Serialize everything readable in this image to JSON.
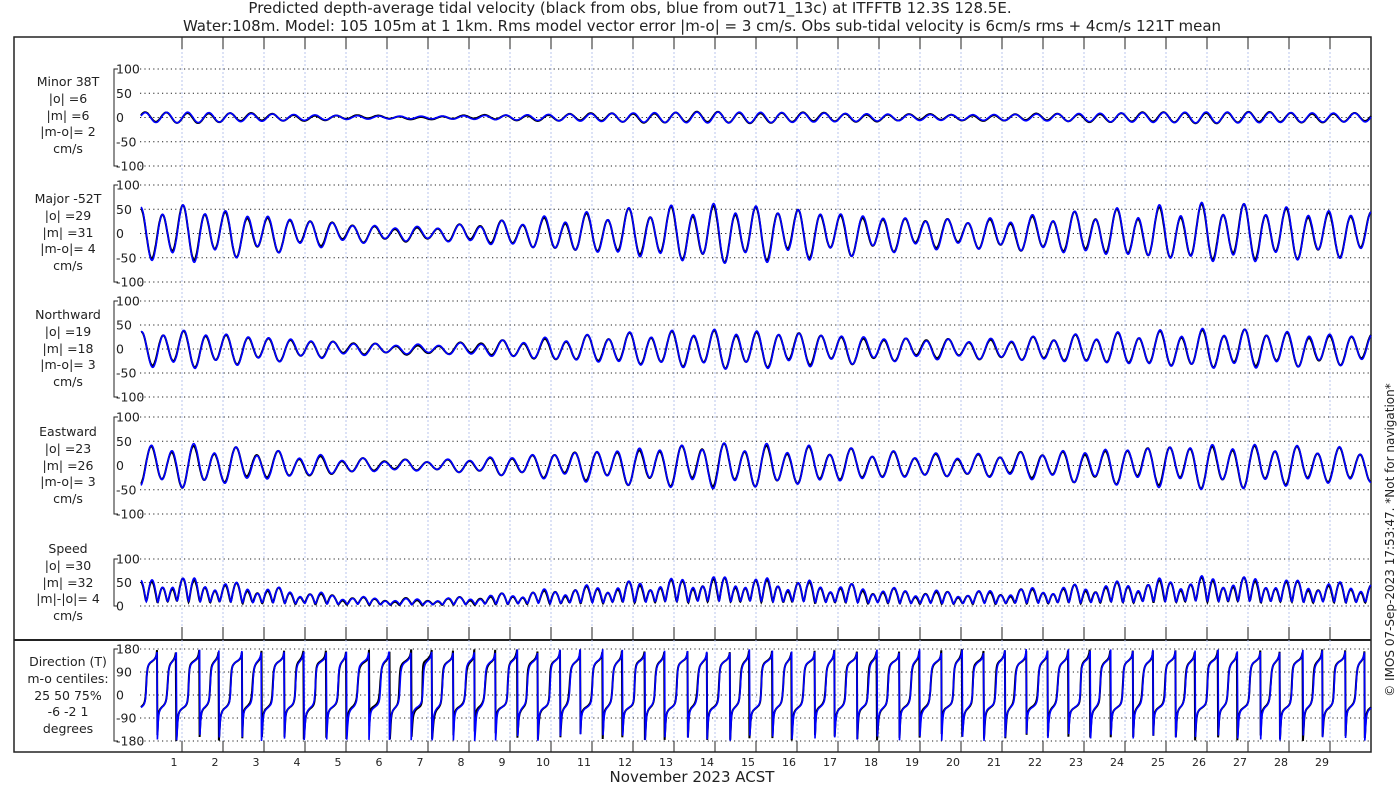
{
  "header": {
    "title_line1": "Predicted depth-average tidal velocity (black from obs, blue from out71_13c) at ITFFTB 12.3S 128.5E.",
    "title_line2": "Water:108m. Model: 105 105m at 1 1km. Rms model vector error |m-o| = 3 cm/s. Obs sub-tidal velocity is 6cm/s rms + 4cm/s 121T mean"
  },
  "footer": {
    "xlabel": "November 2023 ACST",
    "credit": "© IMOS 07-Sep-2023 17:53:47. *Not for navigation*"
  },
  "colors": {
    "obs": "#000000",
    "model": "#0000ff",
    "grid_h": "#000000",
    "grid_v": "#b8c4ee"
  },
  "chart_data": {
    "type": "line",
    "x_days": {
      "range": [
        0,
        30
      ],
      "tick_labels": [
        "1",
        "2",
        "3",
        "4",
        "5",
        "6",
        "7",
        "8",
        "9",
        "10",
        "11",
        "12",
        "13",
        "14",
        "15",
        "16",
        "17",
        "18",
        "19",
        "20",
        "21",
        "22",
        "23",
        "24",
        "25",
        "26",
        "27",
        "28",
        "29"
      ]
    },
    "legend": [
      "black from obs",
      "blue from out71_13c"
    ],
    "major_axis_deg": -52,
    "minor_axis_deg": 38,
    "daily_major_amplitude_cms": [
      55,
      62,
      52,
      42,
      32,
      22,
      16,
      15,
      20,
      28,
      36,
      44,
      52,
      58,
      63,
      60,
      55,
      48,
      40,
      34,
      31,
      34,
      40,
      46,
      52,
      58,
      63,
      61,
      56,
      50
    ],
    "panels": [
      {
        "id": "minor",
        "labels": [
          "Minor 38T",
          "|o| =6",
          "|m| =6",
          "|m-o|= 2",
          "cm/s"
        ],
        "ylim": [
          -100,
          100
        ],
        "yticks": [
          100,
          50,
          0,
          -50,
          -100
        ]
      },
      {
        "id": "major",
        "labels": [
          "Major -52T",
          "|o| =29",
          "|m| =31",
          "|m-o|= 4",
          "cm/s"
        ],
        "ylim": [
          -100,
          100
        ],
        "yticks": [
          100,
          50,
          0,
          -50,
          -100
        ]
      },
      {
        "id": "north",
        "labels": [
          "Northward",
          "|o| =19",
          "|m| =18",
          "|m-o|= 3",
          "cm/s"
        ],
        "ylim": [
          -100,
          100
        ],
        "yticks": [
          100,
          50,
          0,
          -50,
          -100
        ]
      },
      {
        "id": "east",
        "labels": [
          "Eastward",
          "|o| =23",
          "|m| =26",
          "|m-o|= 3",
          "cm/s"
        ],
        "ylim": [
          -100,
          100
        ],
        "yticks": [
          100,
          50,
          0,
          -50,
          -100
        ]
      },
      {
        "id": "speed",
        "labels": [
          "Speed",
          "|o| =30",
          "|m| =32",
          "|m|-|o|= 4",
          "cm/s"
        ],
        "ylim": [
          0,
          100
        ],
        "yticks": [
          100,
          50,
          0
        ]
      },
      {
        "id": "direction",
        "labels": [
          "Direction (T)",
          "m-o centiles:",
          "25  50  75%",
          "-6 -2  1",
          "degrees"
        ],
        "ylim": [
          -180,
          180
        ],
        "yticks": [
          180,
          90,
          0,
          -90,
          -180
        ]
      }
    ]
  }
}
